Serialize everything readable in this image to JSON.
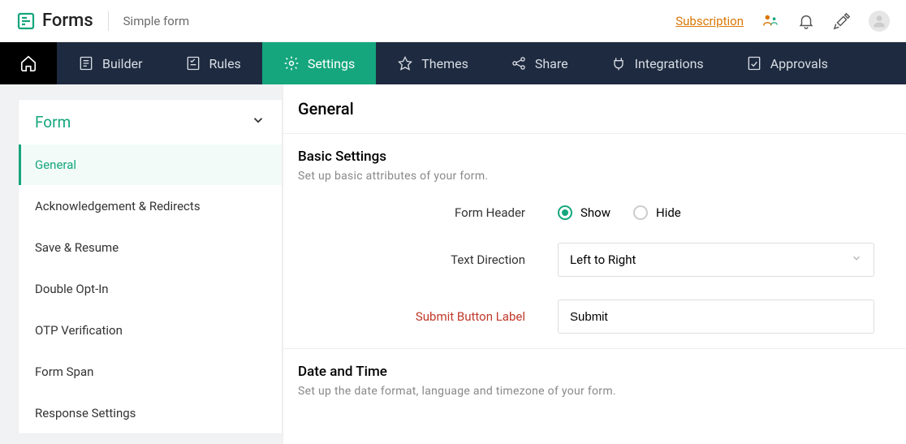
{
  "header": {
    "brand": "Forms",
    "form_name": "Simple form",
    "subscription": "Subscription"
  },
  "nav": {
    "builder": "Builder",
    "rules": "Rules",
    "settings": "Settings",
    "themes": "Themes",
    "share": "Share",
    "integrations": "Integrations",
    "approvals": "Approvals"
  },
  "sidebar": {
    "heading": "Form",
    "items": [
      "General",
      "Acknowledgement & Redirects",
      "Save & Resume",
      "Double Opt-In",
      "OTP Verification",
      "Form Span",
      "Response Settings"
    ]
  },
  "page": {
    "title": "General",
    "basic": {
      "title": "Basic Settings",
      "desc": "Set up basic attributes of your form.",
      "header_label": "Form Header",
      "header_show": "Show",
      "header_hide": "Hide",
      "direction_label": "Text Direction",
      "direction_value": "Left to Right",
      "submit_label": "Submit Button Label",
      "submit_value": "Submit"
    },
    "datetime": {
      "title": "Date and Time",
      "desc": "Set up the date format, language and timezone of your form."
    }
  }
}
